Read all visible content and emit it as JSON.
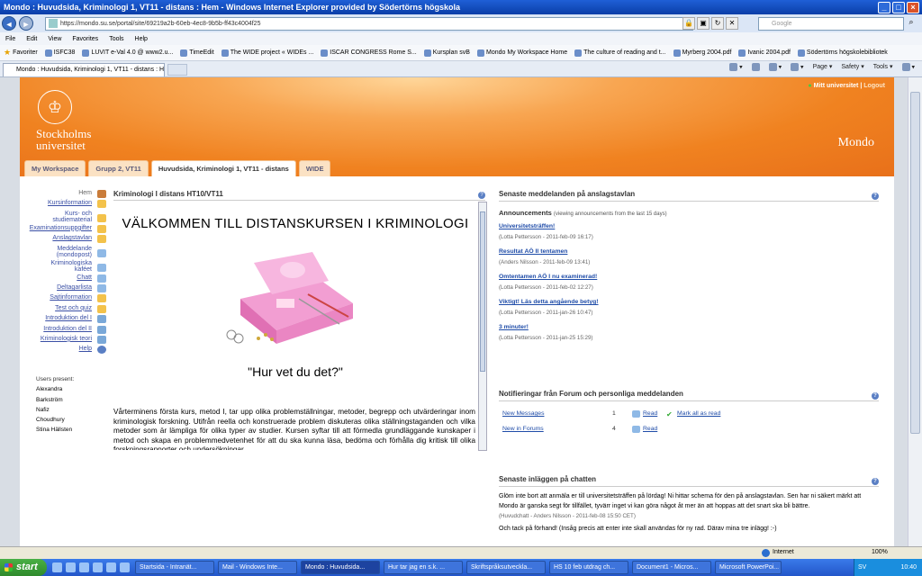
{
  "window": {
    "title": "Mondo : Huvudsida, Kriminologi 1, VT11 - distans : Hem - Windows Internet Explorer provided by Södertörns högskola"
  },
  "browser": {
    "url": "https://mondo.su.se/portal/site/69219a2b-60eb-4ec8-9b5b-ff43c4004f25",
    "search_placeholder": "Google",
    "menu": [
      "File",
      "Edit",
      "View",
      "Favorites",
      "Tools",
      "Help"
    ],
    "favorites_label": "Favoriter",
    "favorites": [
      "ISFC38",
      "LUVIT e-Val 4.0 @ www2.u...",
      "TimeEdit",
      "The WIDE project « WIDEs ...",
      "ISCAR CONGRESS Rome S...",
      "Kursplan svB",
      "Mondo My Workspace Home",
      "The culture of reading and t...",
      "Myrberg 2004.pdf",
      "Ivanic 2004.pdf",
      "Södertörns högskolebibliotek"
    ],
    "tab_title": "Mondo : Huvudsida, Kriminologi 1, VT11 - distans : Hem",
    "commands": [
      "Page",
      "Safety",
      "Tools"
    ]
  },
  "header": {
    "university_line1": "Stockholms",
    "university_line2": "universitet",
    "my_university": "Mitt universitet",
    "separator": "|",
    "logout": "Logout",
    "brand": "Mondo",
    "tabs": [
      "My Workspace",
      "Grupp 2, VT11",
      "Huvudsida, Kriminologi 1, VT11 - distans",
      "WIDE"
    ]
  },
  "sidebar": {
    "items": [
      "Hem",
      "Kursinformation",
      "Kurs- och studiematerial",
      "Examinationsuppgifter",
      "Anslagstavlan",
      "Meddelande (mondopost)",
      "Kriminologiska kaféet",
      "Chatt",
      "Deltagarlista",
      "Sajtinformation",
      "Test och quiz",
      "Introduktion del I",
      "Introduktion del II",
      "Kriminologisk teori",
      "Help"
    ],
    "users_present_label": "Users present:",
    "users": [
      "Alexandra",
      "Barkström",
      "Nafiz",
      "Choudhury",
      "Stina Hällsten"
    ]
  },
  "center": {
    "heading": "Kriminologi I distans HT10/VT11",
    "welcome": "VÄLKOMMEN TILL DISTANSKURSEN I KRIMINOLOGI",
    "question": "\"Hur vet du det?\"",
    "body": "Vårterminens första kurs, metod I, tar upp olika problemställningar, metoder, begrepp och utvärderingar inom kriminologisk forskning. Utifrån reella och konstruerade problem diskuteras olika ställningstaganden och vilka metoder som är lämpliga för olika typer av studier. Kursen syftar till att förmedla grundläggande kunskaper i metod och skapa en problemmedvetenhet för att du ska kunna läsa, bedöma och förhålla dig kritisk till olika forskningsrapporter och undersökningar."
  },
  "announcements": {
    "heading": "Senaste meddelanden på anslagstavlan",
    "label": "Announcements",
    "note": "(viewing announcements from the last 15 days)",
    "items": [
      {
        "title": "Universitetsträffen!",
        "meta": "(Lotta Pettersson - 2011-feb-09 16:17)"
      },
      {
        "title": "Resultat AÖ II tentamen",
        "meta": "(Anders Nilsson - 2011-feb-09 13:41)"
      },
      {
        "title": "Omtentamen AÖ I nu examinerad!",
        "meta": "(Lotta Pettersson - 2011-feb-02 12:27)"
      },
      {
        "title": "Viktigt! Läs detta angående betyg!",
        "meta": "(Lotta Pettersson - 2011-jan-26 10:47)"
      },
      {
        "title": "3 minuter!",
        "meta": "(Lotta Pettersson - 2011-jan-25 15:29)"
      }
    ]
  },
  "notifications": {
    "heading": "Notifieringar från Forum och personliga meddelanden",
    "rows": [
      {
        "label": "New Messages",
        "count": "1",
        "read": "Read",
        "mark": "Mark all as read"
      },
      {
        "label": "New in Forums",
        "count": "4",
        "read": "Read"
      }
    ]
  },
  "chat": {
    "heading": "Senaste inläggen på chatten",
    "msg1": "Glöm inte bort att anmäla er till universitetsträffen på lördag! Ni hittar schema för den på anslagstavlan. Sen har ni säkert märkt att Mondo är ganska segt för tillfället, tyvärr inget vi kan göra något åt mer än att hoppas att det snart ska bli bättre.",
    "meta1": "(Huvudchatt - Anders Nilsson - 2011-feb-08 15:50 CET)",
    "msg2": "Och tack på förhand! (Insåg precis att enter inte skall användas för ny rad. Därav mina tre inlägg! :-)"
  },
  "status": {
    "zone": "Internet",
    "zoom": "100%"
  },
  "taskbar": {
    "start": "start",
    "items": [
      "Startsida - Intranät...",
      "Mail - Windows Inte...",
      "Mondo : Huvudsida...",
      "Hur tar jag en s.k. ...",
      "Skriftspråksutveckla...",
      "HS 10 feb utdrag ch...",
      "Document1 - Micros...",
      "Microsoft PowerPoi..."
    ],
    "lang": "SV",
    "time": "10:40"
  }
}
